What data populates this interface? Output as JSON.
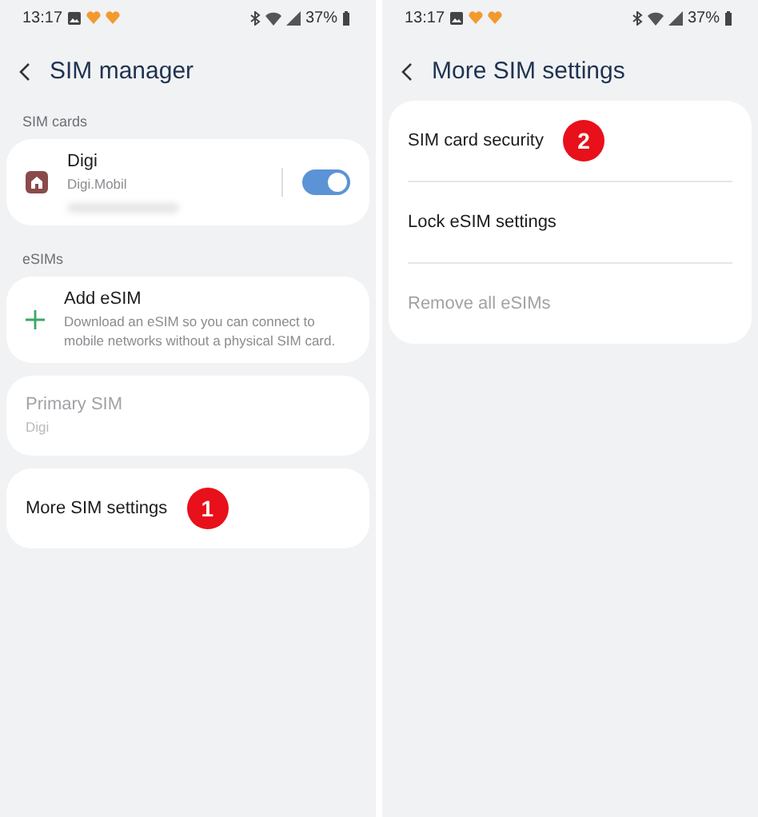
{
  "screens": [
    {
      "status": {
        "time": "13:17",
        "battery": "37%"
      },
      "title": "SIM manager",
      "groups": [
        {
          "header": "SIM cards",
          "items": [
            {
              "kind": "sim",
              "title": "Digi",
              "subtitle": "Digi.Mobil",
              "disabled": false,
              "on": true
            }
          ]
        },
        {
          "header": "eSIMs",
          "items": [
            {
              "kind": "add",
              "title": "Add eSIM",
              "subtitle": "Download an eSIM so you can connect to mobile networks without a physical SIM card.",
              "disabled": false
            }
          ]
        },
        {
          "items": [
            {
              "kind": "plain",
              "title": "Primary SIM",
              "subtitle": "Digi",
              "disabled": true
            }
          ]
        },
        {
          "items": [
            {
              "kind": "plain",
              "title": "More SIM settings",
              "disabled": false,
              "badge": "1"
            }
          ]
        }
      ]
    },
    {
      "status": {
        "time": "13:17",
        "battery": "37%"
      },
      "title": "More SIM settings",
      "groups": [
        {
          "items": [
            {
              "kind": "plain",
              "title": "SIM card security",
              "disabled": false,
              "badge": "2"
            },
            {
              "kind": "plain",
              "title": "Lock eSIM settings",
              "disabled": false
            },
            {
              "kind": "plain",
              "title": "Remove all eSIMs",
              "disabled": true
            }
          ]
        }
      ]
    }
  ]
}
